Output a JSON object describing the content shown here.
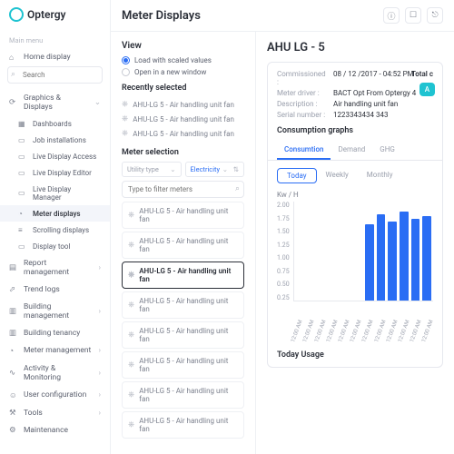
{
  "brand": "Optergy",
  "sidebar": {
    "section": "Main menu",
    "home": "Home display",
    "search_ph": "Search",
    "groups": [
      {
        "label": "Graphics & Displays",
        "items": [
          "Dashboards",
          "Job installations",
          "Live Display Access",
          "Live Display Editor",
          "Live Display Manager",
          "Meter displays",
          "Scrolling displays",
          "Display tool"
        ]
      },
      {
        "label": "Report management"
      },
      {
        "label": "Trend logs"
      },
      {
        "label": "Building management"
      },
      {
        "label": "Building tenancy"
      },
      {
        "label": "Meter management"
      },
      {
        "label": "Activity & Monitoring"
      },
      {
        "label": "User configuration"
      },
      {
        "label": "Tools"
      },
      {
        "label": "Maintenance"
      }
    ]
  },
  "page_title": "Meter Displays",
  "view": {
    "h": "View",
    "opt1": "Load with scaled values",
    "opt2": "Open in a new window"
  },
  "recent": {
    "h": "Recently selected",
    "items": [
      "AHU-LG 5 - Air handling unit fan",
      "AHU-LG 5 - Air handling unit fan",
      "AHU-LG 5 - Air handling unit fan"
    ]
  },
  "msel": {
    "h": "Meter selection",
    "utility": "Utility type",
    "elec": "Electricity",
    "filter_ph": "Type to filter meters",
    "list": [
      "AHU-LG 5 - Air handling unit fan",
      "AHU-LG 5 - Air handling unit fan",
      "AHU-LG 5 - Air handling unit fan",
      "AHU-LG 5 - Air handling unit fan",
      "AHU-LG 5 - Air handling unit fan",
      "AHU-LG 5 - Air handling unit fan",
      "AHU-LG 5 - Air handling unit fan",
      "AHU-LG 5 - Air handling unit fan"
    ]
  },
  "detail": {
    "title": "AHU LG - 5",
    "meta": [
      {
        "k": "Commissioned :",
        "v": "08 / 12 /2017 - 04:52 PM"
      },
      {
        "k": "Meter driver :",
        "v": "BACT Opt From Optergy 4"
      },
      {
        "k": "Description :",
        "v": "Air handling unit fan"
      },
      {
        "k": "Serial number :",
        "v": "1223343434 343"
      }
    ],
    "total": "Total c",
    "add": "A",
    "graphs_h": "Consumption graphs",
    "tabs": [
      "Consumtion",
      "Demand",
      "GHG"
    ],
    "ranges": [
      "Today",
      "Weekly",
      "Monthly"
    ],
    "ylabel": "Kw / H",
    "today_usage": "Today Usage"
  },
  "chart_data": {
    "type": "bar",
    "categories": [
      "12:00 AM",
      "12:00 AM",
      "12:00 AM",
      "12:00 AM",
      "12:00 AM",
      "12:00 AM",
      "12:00 AM",
      "12:00 AM",
      "12:00 AM",
      "12:00 AM",
      "12:00 AM",
      "12:00 AM"
    ],
    "values": [
      0,
      0,
      0,
      0,
      0,
      0,
      1.55,
      1.75,
      1.6,
      1.8,
      1.65,
      1.7
    ],
    "yticks": [
      "2.00",
      "1.75",
      "1.50",
      "1.25",
      "1.00",
      "0.75",
      "0.50",
      "0.25"
    ],
    "ylim": [
      0,
      2.0
    ]
  }
}
